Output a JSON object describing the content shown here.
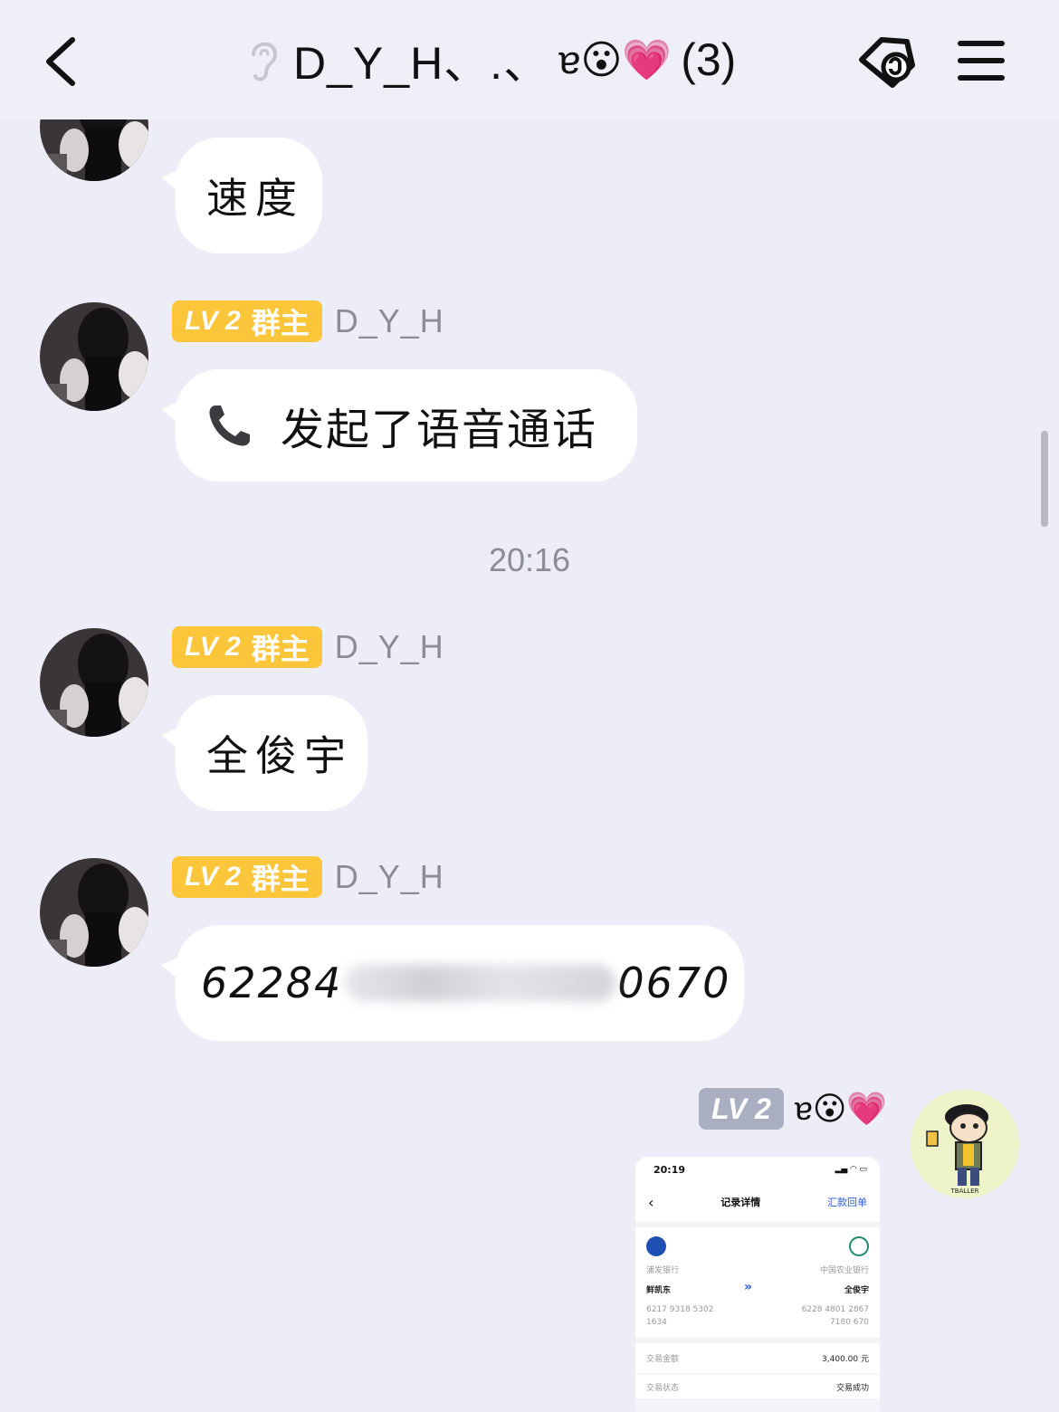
{
  "header": {
    "title": "D_Y_H、.、",
    "title_emoji": "ɐ😮💗",
    "member_count": "(3)"
  },
  "messages": [
    {
      "sender": "",
      "badge_level": "",
      "badge_role": "",
      "text": "速度"
    },
    {
      "sender": "D_Y_H",
      "badge_level": "LV 2",
      "badge_role": "群主",
      "text": "发起了语音通话"
    },
    {
      "sender": "D_Y_H",
      "badge_level": "LV 2",
      "badge_role": "群主",
      "text": "全俊宇"
    },
    {
      "sender": "D_Y_H",
      "badge_level": "LV 2",
      "badge_role": "群主",
      "text_start": "62284",
      "text_end": "0670"
    }
  ],
  "timestamp": "20:16",
  "self": {
    "badge_level": "LV 2",
    "name_emoji": "ɐ😮💗"
  },
  "receipt": {
    "status_time": "20:19",
    "title": "记录详情",
    "link": "汇款回单",
    "from_bank": "浦发银行",
    "from_name": "鲜凯东",
    "from_account": "6217 9318 5302",
    "from_account2": "1634",
    "to_bank": "中国农业银行",
    "to_name": "全俊宇",
    "to_account": "6228 4801 2867",
    "to_account2": "7180 670",
    "amount_label": "交易金额",
    "amount": "3,400.00 元",
    "status_label": "交易状态",
    "status": "交易成功"
  },
  "colors": {
    "background": "#ecedf6",
    "badge_owner": "#fbc63a",
    "badge_self": "#a9aec1",
    "bubble": "#ffffff"
  }
}
